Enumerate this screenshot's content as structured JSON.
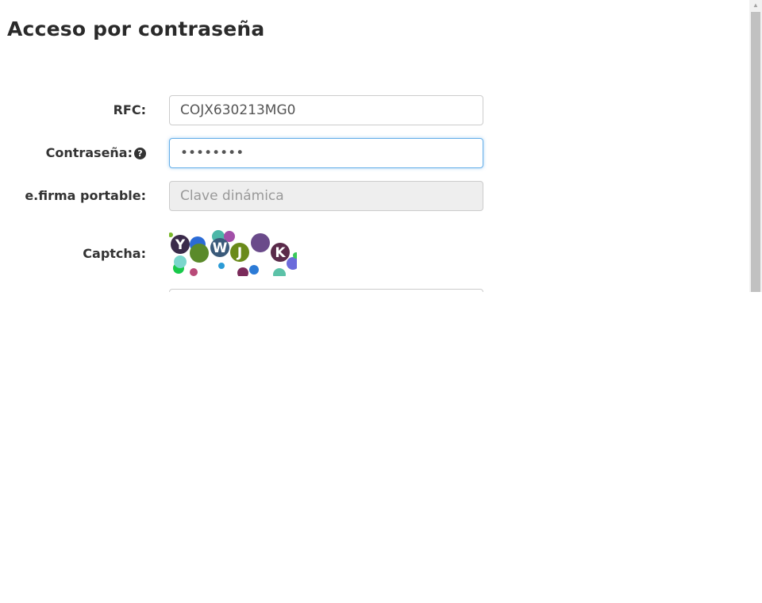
{
  "page": {
    "title": "Acceso por contraseña"
  },
  "form": {
    "rfc": {
      "label": "RFC:",
      "value": "COJX630213MG0"
    },
    "password": {
      "label": "Contraseña:",
      "value": "••••••••",
      "help_icon": "question-circle-icon"
    },
    "efirma": {
      "label": "e.firma portable:",
      "placeholder": "Clave dinámica"
    },
    "captcha": {
      "label": "Captcha:",
      "text": "YWJK"
    }
  },
  "colors": {
    "focus_border": "#66afe9",
    "disabled_bg": "#eeeeee"
  }
}
